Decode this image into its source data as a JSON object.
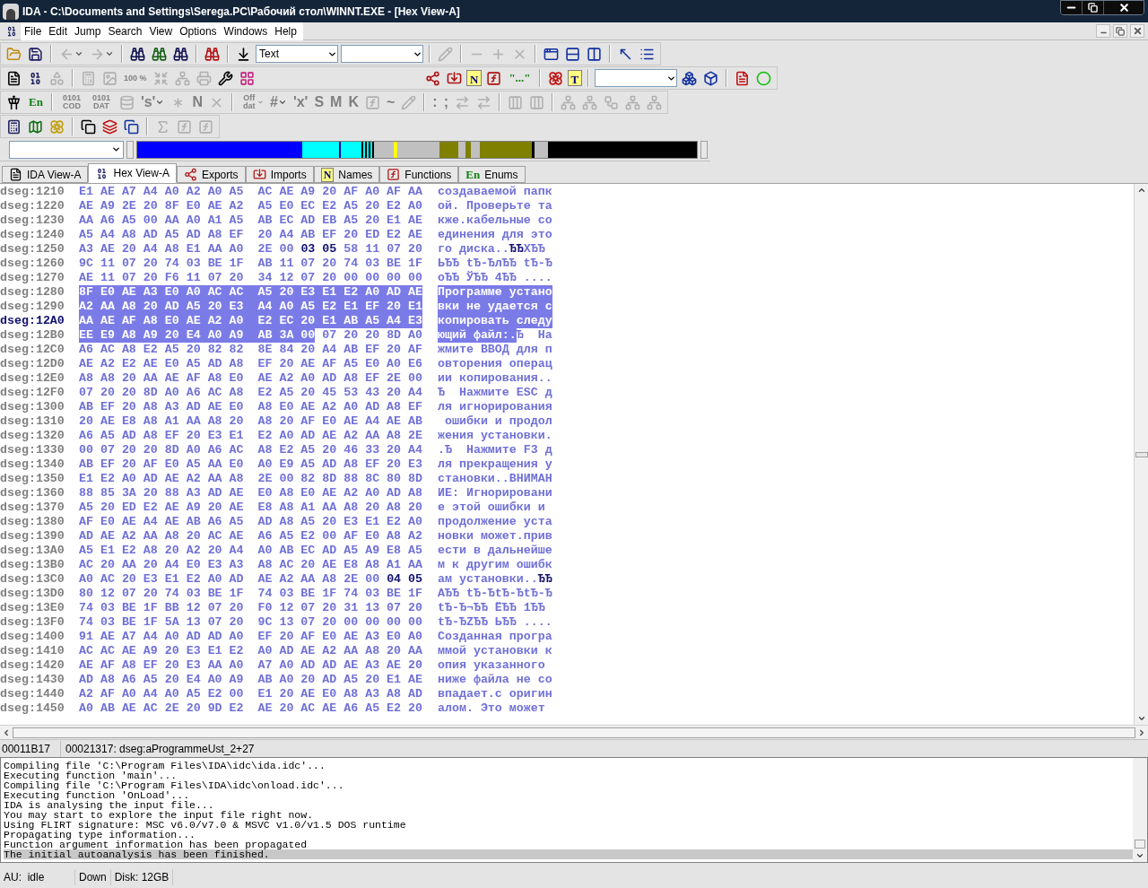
{
  "window": {
    "title": "IDA - C:\\Documents and Settings\\Serega.PC\\Рабочий стол\\WINNT.EXE - [Hex View-A]"
  },
  "menu": [
    "File",
    "Edit",
    "Jump",
    "Search",
    "View",
    "Options",
    "Windows",
    "Help"
  ],
  "toolbars": [
    [
      {
        "kind": "icon",
        "disabled": false
      },
      {
        "kind": "icon",
        "disabled": false
      },
      {
        "kind": "sep"
      },
      {
        "kind": "dropdown_icon",
        "disabled": true
      },
      {
        "kind": "dropdown_icon",
        "disabled": true
      },
      {
        "kind": "sep"
      },
      {
        "kind": "icon",
        "disabled": false
      },
      {
        "kind": "icon",
        "disabled": false
      },
      {
        "kind": "icon",
        "disabled": false
      },
      {
        "kind": "sep"
      },
      {
        "kind": "icon",
        "disabled": false
      },
      {
        "kind": "sep"
      },
      {
        "kind": "icon",
        "disabled": false
      },
      {
        "kind": "combo",
        "value": "Text"
      },
      {
        "kind": "combo"
      },
      {
        "kind": "sep"
      },
      {
        "kind": "icon",
        "disabled": true
      },
      {
        "kind": "sep"
      },
      {
        "kind": "icon",
        "disabled": true
      },
      {
        "kind": "icon",
        "disabled": true
      },
      {
        "kind": "icon",
        "disabled": true
      },
      {
        "kind": "sep"
      },
      {
        "kind": "icon",
        "disabled": false
      },
      {
        "kind": "icon",
        "disabled": false
      },
      {
        "kind": "icon",
        "disabled": false
      },
      {
        "kind": "sep"
      },
      {
        "kind": "icon",
        "disabled": false
      },
      {
        "kind": "icon",
        "disabled": false
      }
    ],
    [
      {
        "kind": "icon",
        "disabled": false
      },
      {
        "kind": "icon",
        "disabled": false
      },
      {
        "kind": "icon",
        "disabled": true
      },
      {
        "kind": "sep"
      },
      {
        "kind": "icon",
        "disabled": true
      },
      {
        "kind": "icon",
        "disabled": true
      },
      {
        "kind": "glyph",
        "label": "100 %",
        "disabled": true
      },
      {
        "kind": "icon",
        "disabled": true
      },
      {
        "kind": "icon",
        "disabled": true
      },
      {
        "kind": "icon",
        "disabled": true
      },
      {
        "kind": "icon",
        "disabled": false
      },
      {
        "kind": "icon",
        "disabled": false
      },
      {
        "kind": "gap"
      },
      {
        "kind": "icon",
        "disabled": false
      },
      {
        "kind": "icon",
        "disabled": false
      },
      {
        "kind": "tag",
        "label": "N",
        "disabled": false
      },
      {
        "kind": "icon",
        "disabled": false
      },
      {
        "kind": "label",
        "label": "\"...\"",
        "disabled": false
      },
      {
        "kind": "sep"
      },
      {
        "kind": "icon",
        "disabled": false
      },
      {
        "kind": "tag",
        "label": "T",
        "disabled": false
      },
      {
        "kind": "sep"
      },
      {
        "kind": "combo"
      },
      {
        "kind": "icon",
        "disabled": false
      },
      {
        "kind": "icon",
        "disabled": false
      },
      {
        "kind": "sep"
      },
      {
        "kind": "icon",
        "disabled": false
      },
      {
        "kind": "icon",
        "disabled": false
      }
    ],
    [
      {
        "kind": "icon",
        "disabled": false
      },
      {
        "kind": "label",
        "label": "En",
        "disabled": false
      },
      {
        "kind": "sep"
      },
      {
        "kind": "glyph",
        "label": "0101 COD",
        "disabled": true
      },
      {
        "kind": "glyph",
        "label": "0101 DAT",
        "disabled": true
      },
      {
        "kind": "icon",
        "disabled": true
      },
      {
        "kind": "dropdown_glyph",
        "label": "'s'",
        "disabled": true
      },
      {
        "kind": "icon",
        "disabled": true
      },
      {
        "kind": "glyph",
        "label": "N",
        "disabled": true
      },
      {
        "kind": "icon",
        "disabled": true
      },
      {
        "kind": "sep"
      },
      {
        "kind": "dropdown_glyph",
        "label": "Off dat",
        "disabled": true
      },
      {
        "kind": "dropdown_glyph",
        "label": "#",
        "disabled": true
      },
      {
        "kind": "glyph",
        "label": "'x'",
        "disabled": true
      },
      {
        "kind": "glyph",
        "label": "S",
        "disabled": true
      },
      {
        "kind": "glyph",
        "label": "M",
        "disabled": true
      },
      {
        "kind": "glyph",
        "label": "K",
        "disabled": true
      },
      {
        "kind": "icon",
        "disabled": true
      },
      {
        "kind": "glyph",
        "label": "~",
        "disabled": true
      },
      {
        "kind": "icon",
        "disabled": true
      },
      {
        "kind": "sep"
      },
      {
        "kind": "glyph",
        "label": ":",
        "disabled": true
      },
      {
        "kind": "glyph",
        "label": ";",
        "disabled": true
      },
      {
        "kind": "icon",
        "disabled": true
      },
      {
        "kind": "icon",
        "disabled": true
      },
      {
        "kind": "sep"
      },
      {
        "kind": "icon",
        "disabled": true
      },
      {
        "kind": "icon",
        "disabled": true
      },
      {
        "kind": "sep"
      },
      {
        "kind": "icon",
        "disabled": true
      },
      {
        "kind": "icon",
        "disabled": true
      },
      {
        "kind": "icon",
        "disabled": true
      },
      {
        "kind": "icon",
        "disabled": true
      },
      {
        "kind": "icon",
        "disabled": true
      }
    ],
    [
      {
        "kind": "icon",
        "disabled": false
      },
      {
        "kind": "icon",
        "disabled": false
      },
      {
        "kind": "icon",
        "disabled": false
      },
      {
        "kind": "sep"
      },
      {
        "kind": "icon",
        "disabled": false
      },
      {
        "kind": "icon",
        "disabled": false
      },
      {
        "kind": "icon",
        "disabled": false
      },
      {
        "kind": "sep"
      },
      {
        "kind": "icon",
        "disabled": true
      },
      {
        "kind": "icon",
        "disabled": true
      },
      {
        "kind": "icon",
        "disabled": true
      }
    ]
  ],
  "tabs": [
    {
      "label": "IDA View-A",
      "selected": false,
      "kind": "icon"
    },
    {
      "label": "Hex View-A",
      "selected": true,
      "kind": "icon"
    },
    {
      "label": "Exports",
      "selected": false,
      "kind": "icon"
    },
    {
      "label": "Imports",
      "selected": false,
      "kind": "icon"
    },
    {
      "label": "Names",
      "selected": false,
      "kind": "tag",
      "badge": "N"
    },
    {
      "label": "Functions",
      "selected": false,
      "kind": "icon"
    },
    {
      "label": "Enums",
      "selected": false,
      "kind": "label",
      "badge": "En"
    }
  ],
  "hex_rows": [
    {
      "address": "dseg:1210",
      "hex": "E1 AE A7 A4 A0 A2 A0 A5  AC AE A9 20 AF A0 AF AA",
      "text": "создаваемой папк",
      "selected": false,
      "current": false
    },
    {
      "address": "dseg:1220",
      "hex": "AE A9 2E 20 8F E0 AE A2  A5 E0 EC E2 A5 20 E2 A0",
      "text": "ой. Проверьте та",
      "selected": false,
      "current": false
    },
    {
      "address": "dseg:1230",
      "hex": "AA A6 A5 00 AA A0 A1 A5  AB EC AD EB A5 20 E1 AE",
      "text": "кже.кабельные со",
      "selected": false,
      "current": false
    },
    {
      "address": "dseg:1240",
      "hex": "A5 A4 A8 AD A5 AD A8 EF  20 A4 AB EF 20 ED E2 AE",
      "text": "единения для это",
      "selected": false,
      "current": false
    },
    {
      "address": "dseg:1250",
      "hex": "A3 AE 20 A4 A8 E1 AA A0  2E 00 **03 05** 58 11 07 20",
      "text": "го диска..**ЂЂ**XЂЂ",
      "selected": false,
      "current": false
    },
    {
      "address": "dseg:1260",
      "hex": "9C 11 07 20 74 03 BE 1F  AB 11 07 20 74 03 BE 1F",
      "text": "ЬЂЂ tЂ-ЂлЂЂ tЂ-Ђ",
      "selected": false,
      "current": false
    },
    {
      "address": "dseg:1270",
      "hex": "AE 11 07 20 F6 11 07 20  34 12 07 20 00 00 00 00",
      "text": "оЂЂ ЎЂЂ 4ЂЂ ....",
      "selected": false,
      "current": false
    },
    {
      "address": "dseg:1280",
      "hex": "8F E0 AE A3 E0 A0 AC AC  A5 20 E3 E1 E2 A0 AD AE",
      "text": "Программе устано",
      "selected": true,
      "current": false
    },
    {
      "address": "dseg:1290",
      "hex": "A2 AA A8 20 AD A5 20 E3  A4 A0 A5 E2 E1 EF 20 E1",
      "text": "вки не удается с",
      "selected": true,
      "current": false
    },
    {
      "address": "dseg:12A0",
      "hex": "AA AE AF A8 E0 AE A2 A0  E2 EC 20 E1 AB A5 A4 E3",
      "text": "копировать следу",
      "selected": true,
      "current": true
    },
    {
      "address": "dseg:12B0",
      "hex": "EE E9 A8 A9 20 E4 A0 A9  AB 3A 00",
      "text": "ющий файл:.",
      "selected": true,
      "current": false,
      "hex_tail": "07 20 20 8D A0",
      "text_tail": "Ђ  На"
    },
    {
      "address": "dseg:12C0",
      "hex": "A6 AC A8 E2 A5 20 82 82  8E 84 20 A4 AB EF 20 AF",
      "text": "жмите ВВОД для п",
      "selected": false,
      "current": false
    },
    {
      "address": "dseg:12D0",
      "hex": "AE A2 E2 AE E0 A5 AD A8  EF 20 AE AF A5 E0 A0 E6",
      "text": "овторения операц",
      "selected": false,
      "current": false
    },
    {
      "address": "dseg:12E0",
      "hex": "A8 A8 20 AA AE AF A8 E0  AE A2 A0 AD A8 EF 2E 00",
      "text": "ии копирования..",
      "selected": false,
      "current": false
    },
    {
      "address": "dseg:12F0",
      "hex": "07 20 20 8D A0 A6 AC A8  E2 A5 20 45 53 43 20 A4",
      "text": "Ђ  Нажмите ESC д",
      "selected": false,
      "current": false
    },
    {
      "address": "dseg:1300",
      "hex": "AB EF 20 A8 A3 AD AE E0  A8 E0 AE A2 A0 AD A8 EF",
      "text": "ля игнорирования",
      "selected": false,
      "current": false
    },
    {
      "address": "dseg:1310",
      "hex": "20 AE E8 A8 A1 AA A8 20  A8 20 AF E0 AE A4 AE AB",
      "text": " ошибки и продол",
      "selected": false,
      "current": false
    },
    {
      "address": "dseg:1320",
      "hex": "A6 A5 AD A8 EF 20 E3 E1  E2 A0 AD AE A2 AA A8 2E",
      "text": "жения установки.",
      "selected": false,
      "current": false
    },
    {
      "address": "dseg:1330",
      "hex": "00 07 20 20 8D A0 A6 AC  A8 E2 A5 20 46 33 20 A4",
      "text": ".Ђ  Нажмите F3 д",
      "selected": false,
      "current": false
    },
    {
      "address": "dseg:1340",
      "hex": "AB EF 20 AF E0 A5 AA E0  A0 E9 A5 AD A8 EF 20 E3",
      "text": "ля прекращения у",
      "selected": false,
      "current": false
    },
    {
      "address": "dseg:1350",
      "hex": "E1 E2 A0 AD AE A2 AA A8  2E 00 82 8D 88 8C 80 8D",
      "text": "становки..ВНИМАН",
      "selected": false,
      "current": false
    },
    {
      "address": "dseg:1360",
      "hex": "88 85 3A 20 88 A3 AD AE  E0 A8 E0 AE A2 A0 AD A8",
      "text": "ИЕ: Игнорировани",
      "selected": false,
      "current": false
    },
    {
      "address": "dseg:1370",
      "hex": "A5 20 ED E2 AE A9 20 AE  E8 A8 A1 AA A8 20 A8 20",
      "text": "е этой ошибки и",
      "selected": false,
      "current": false
    },
    {
      "address": "dseg:1380",
      "hex": "AF E0 AE A4 AE AB A6 A5  AD A8 A5 20 E3 E1 E2 A0",
      "text": "продолжение уста",
      "selected": false,
      "current": false
    },
    {
      "address": "dseg:1390",
      "hex": "AD AE A2 AA A8 20 AC AE  A6 A5 E2 00 AF E0 A8 A2",
      "text": "новки может.прив",
      "selected": false,
      "current": false
    },
    {
      "address": "dseg:13A0",
      "hex": "A5 E1 E2 A8 20 A2 20 A4  A0 AB EC AD A5 A9 E8 A5",
      "text": "ести в дальнейше",
      "selected": false,
      "current": false
    },
    {
      "address": "dseg:13B0",
      "hex": "AC 20 AA 20 A4 E0 E3 A3  A8 AC 20 AE E8 A8 A1 AA",
      "text": "м к другим ошибк",
      "selected": false,
      "current": false
    },
    {
      "address": "dseg:13C0",
      "hex": "A0 AC 20 E3 E1 E2 A0 AD  AE A2 AA A8 2E 00 **04 05**",
      "text": "ам установки..**ЂЂ**",
      "selected": false,
      "current": false
    },
    {
      "address": "dseg:13D0",
      "hex": "80 12 07 20 74 03 BE 1F  74 03 BE 1F 74 03 BE 1F",
      "text": "АЂЂ tЂ-ЂtЂ-ЂtЂ-Ђ",
      "selected": false,
      "current": false
    },
    {
      "address": "dseg:13E0",
      "hex": "74 03 BE 1F BB 12 07 20  F0 12 07 20 31 13 07 20",
      "text": "tЂ-Ђ¬ЂЂ ЁЂЂ 1ЂЂ",
      "selected": false,
      "current": false
    },
    {
      "address": "dseg:13F0",
      "hex": "74 03 BE 1F 5A 13 07 20  9C 13 07 20 00 00 00 00",
      "text": "tЂ-ЂZЂЂ ЬЂЂ ....",
      "selected": false,
      "current": false
    },
    {
      "address": "dseg:1400",
      "hex": "91 AE A7 A4 A0 AD AD A0  EF 20 AF E0 AE A3 E0 A0",
      "text": "Созданная програ",
      "selected": false,
      "current": false
    },
    {
      "address": "dseg:1410",
      "hex": "AC AC AE A9 20 E3 E1 E2  A0 AD AE A2 AA A8 20 AA",
      "text": "ммой установки к",
      "selected": false,
      "current": false
    },
    {
      "address": "dseg:1420",
      "hex": "AE AF A8 EF 20 E3 AA A0  A7 A0 AD AD AE A3 AE 20",
      "text": "опия указанного",
      "selected": false,
      "current": false
    },
    {
      "address": "dseg:1430",
      "hex": "AD A8 A6 A5 20 E4 A0 A9  AB A0 20 AD A5 20 E1 AE",
      "text": "ниже файла не со",
      "selected": false,
      "current": false
    },
    {
      "address": "dseg:1440",
      "hex": "A2 AF A0 A4 A0 A5 E2 00  E1 20 AE E0 A8 A3 A8 AD",
      "text": "впадает.с оригин",
      "selected": false,
      "current": false
    },
    {
      "address": "dseg:1450",
      "hex": "A0 AB AE AC 2E 20 9D E2  AE 20 AC AE A6 A5 E2 20",
      "text": "алом. Это может",
      "selected": false,
      "current": false
    }
  ],
  "position": [
    "00011B17",
    "00021317: dseg:aProgrammeUst_2+27"
  ],
  "log": [
    {
      "text": "Compiling file 'C:\\Program Files\\IDA\\idc\\ida.idc'...",
      "selected": false
    },
    {
      "text": "Executing function 'main'...",
      "selected": false
    },
    {
      "text": "Compiling file 'C:\\Program Files\\IDA\\idc\\onload.idc'...",
      "selected": false
    },
    {
      "text": "Executing function 'OnLoad'...",
      "selected": false
    },
    {
      "text": "IDA is analysing the input file...",
      "selected": false
    },
    {
      "text": "You may start to explore the input file right now.",
      "selected": false
    },
    {
      "text": "Using FLIRT signature: MSC v6.0/v7.0 & MSVC v1.0/v1.5 DOS runtime",
      "selected": false
    },
    {
      "text": "Propagating type information...",
      "selected": false
    },
    {
      "text": "Function argument information has been propagated",
      "selected": false
    },
    {
      "text": "The initial autoanalysis has been finished.",
      "selected": true
    }
  ],
  "status_bar": [
    "AU:  idle",
    "Down",
    "Disk: 12GB"
  ]
}
